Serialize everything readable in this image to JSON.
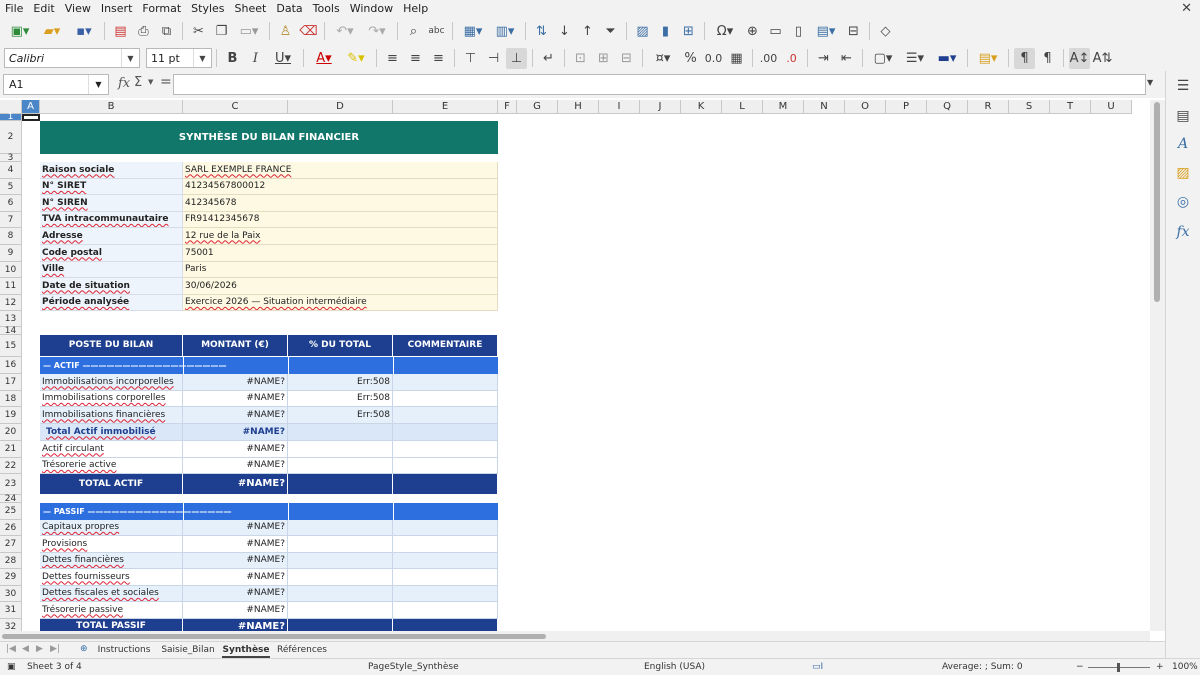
{
  "menu": [
    "File",
    "Edit",
    "View",
    "Insert",
    "Format",
    "Styles",
    "Sheet",
    "Data",
    "Tools",
    "Window",
    "Help"
  ],
  "font_name": "Calibri",
  "font_size": "11 pt",
  "name_box": "A1",
  "columns": [
    "A",
    "B",
    "C",
    "D",
    "E",
    "F",
    "G",
    "H",
    "I",
    "J",
    "K",
    "L",
    "M",
    "N",
    "O",
    "P",
    "Q",
    "R",
    "S",
    "T",
    "U"
  ],
  "selected_column": "A",
  "rows": [
    "1",
    "2",
    "3",
    "4",
    "5",
    "6",
    "7",
    "8",
    "9",
    "10",
    "11",
    "12",
    "13",
    "14",
    "15",
    "16",
    "17",
    "18",
    "19",
    "20",
    "21",
    "22",
    "23",
    "24",
    "25",
    "26",
    "27",
    "28",
    "29",
    "30",
    "31",
    "32"
  ],
  "selected_row": "1",
  "title": "SYNTHÈSE DU BILAN FINANCIER",
  "info": [
    {
      "label": "Raison sociale",
      "value": "SARL EXEMPLE FRANCE"
    },
    {
      "label": "N° SIRET",
      "value": "41234567800012"
    },
    {
      "label": "N° SIREN",
      "value": "412345678"
    },
    {
      "label": "TVA intracommunautaire",
      "value": "FR91412345678"
    },
    {
      "label": "Adresse",
      "value": "12 rue de la Paix"
    },
    {
      "label": "Code postal",
      "value": "75001"
    },
    {
      "label": "Ville",
      "value": "Paris"
    },
    {
      "label": "Date de situation",
      "value": "30/06/2026"
    },
    {
      "label": "Période analysée",
      "value": "Exercice 2026 — Situation intermédiaire"
    }
  ],
  "table_headers": [
    "POSTE DU BILAN",
    "MONTANT (€)",
    "% DU TOTAL",
    "COMMENTAIRE"
  ],
  "actif": {
    "section": "— ACTIF ——————————————————",
    "rows": [
      {
        "poste": "Immobilisations incorporelles",
        "montant": "#NAME?",
        "pct": "Err:508"
      },
      {
        "poste": "Immobilisations corporelles",
        "montant": "#NAME?",
        "pct": "Err:508"
      },
      {
        "poste": "Immobilisations financières",
        "montant": "#NAME?",
        "pct": "Err:508"
      }
    ],
    "subtotal": {
      "poste": "Total Actif immobilisé",
      "montant": "#NAME?"
    },
    "rows2": [
      {
        "poste": "Actif circulant",
        "montant": "#NAME?"
      },
      {
        "poste": "Trésorerie active",
        "montant": "#NAME?"
      }
    ],
    "total": {
      "poste": "TOTAL ACTIF",
      "montant": "#NAME?"
    }
  },
  "passif": {
    "section": "— PASSIF ——————————————————",
    "rows": [
      {
        "poste": "Capitaux propres",
        "montant": "#NAME?"
      },
      {
        "poste": "Provisions",
        "montant": "#NAME?"
      },
      {
        "poste": "Dettes financières",
        "montant": "#NAME?"
      },
      {
        "poste": "Dettes fournisseurs",
        "montant": "#NAME?"
      },
      {
        "poste": "Dettes fiscales et sociales",
        "montant": "#NAME?"
      },
      {
        "poste": "Trésorerie passive",
        "montant": "#NAME?"
      }
    ],
    "total": {
      "poste": "TOTAL PASSIF",
      "montant": "#NAME?"
    }
  },
  "sheet_tabs": [
    "Instructions",
    "Saisie_Bilan",
    "Synthèse",
    "Références"
  ],
  "active_tab": "Synthèse",
  "status": {
    "sheet": "Sheet 3 of 4",
    "page_style": "PageStyle_Synthèse",
    "language": "English (USA)",
    "summary": "Average: ; Sum: 0",
    "zoom": "100%"
  },
  "colors": {
    "title_bg": "#11776b",
    "header_bg": "#1e3f8f",
    "section_bg": "#2e6fe0",
    "label_bg": "#eef4fb",
    "value_bg": "#fdf9e3",
    "alt_row_bg": "#e6f0fb",
    "subtotal_bg": "#d9e7f8"
  }
}
